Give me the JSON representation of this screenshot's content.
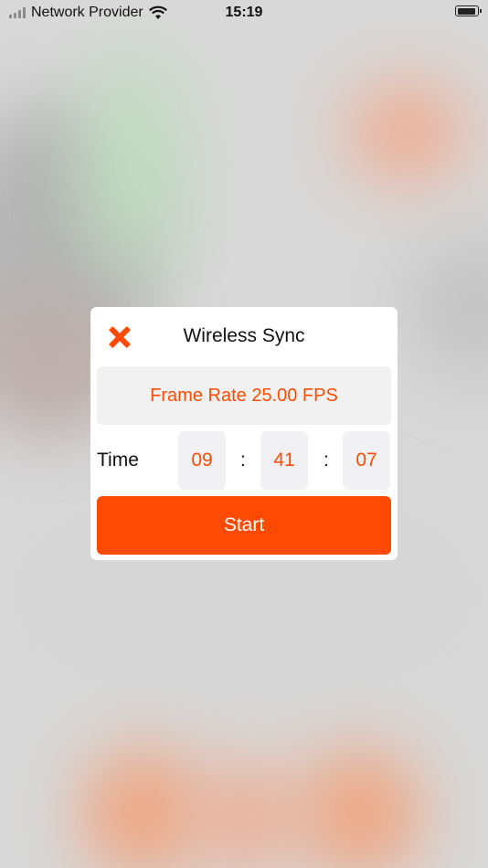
{
  "status_bar": {
    "carrier": "Network Provider",
    "time": "15:19",
    "signal_icon": "signal-bars-icon",
    "wifi_icon": "wifi-icon",
    "battery_icon": "battery-icon"
  },
  "dialog": {
    "title": "Wireless Sync",
    "close_icon": "close-x-icon",
    "frame_rate_label": "Frame Rate 25.00 FPS",
    "time_label": "Time",
    "time": {
      "hours": "09",
      "minutes": "41",
      "seconds": "07",
      "separator": ":"
    },
    "start_label": "Start"
  },
  "colors": {
    "accent": "#fe4a03",
    "field_bg": "#f1f1f1",
    "dialog_bg": "#ffffff"
  }
}
